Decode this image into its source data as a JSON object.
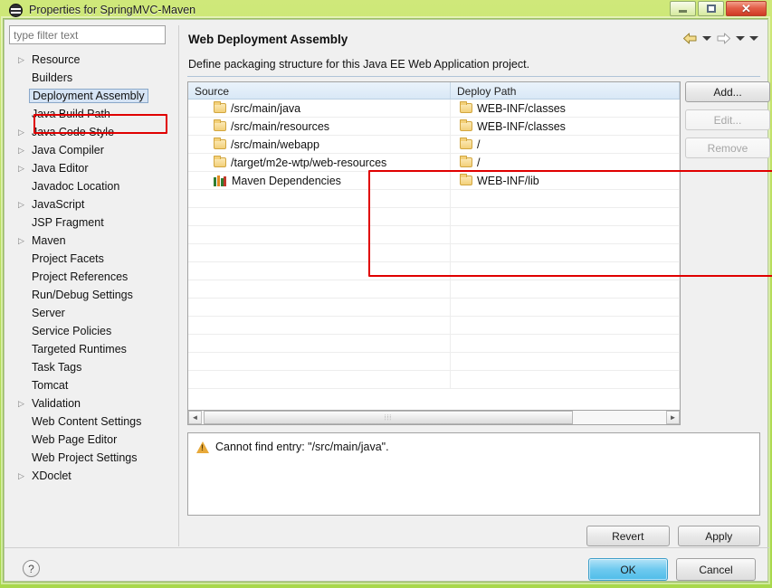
{
  "window": {
    "title": "Properties for SpringMVC-Maven",
    "app_icon": "eclipse-properties-icon",
    "controls": {
      "minimize": "minimize-icon",
      "maximize": "maximize-icon",
      "close": "✕"
    }
  },
  "sidebar": {
    "filter": {
      "placeholder": "type filter text",
      "value": ""
    },
    "items": [
      {
        "label": "Resource",
        "expandable": true,
        "selected": false
      },
      {
        "label": "Builders",
        "expandable": false,
        "selected": false
      },
      {
        "label": "Deployment Assembly",
        "expandable": false,
        "selected": true
      },
      {
        "label": "Java Build Path",
        "expandable": false,
        "selected": false
      },
      {
        "label": "Java Code Style",
        "expandable": true,
        "selected": false
      },
      {
        "label": "Java Compiler",
        "expandable": true,
        "selected": false
      },
      {
        "label": "Java Editor",
        "expandable": true,
        "selected": false
      },
      {
        "label": "Javadoc Location",
        "expandable": false,
        "selected": false
      },
      {
        "label": "JavaScript",
        "expandable": true,
        "selected": false
      },
      {
        "label": "JSP Fragment",
        "expandable": false,
        "selected": false
      },
      {
        "label": "Maven",
        "expandable": true,
        "selected": false
      },
      {
        "label": "Project Facets",
        "expandable": false,
        "selected": false
      },
      {
        "label": "Project References",
        "expandable": false,
        "selected": false
      },
      {
        "label": "Run/Debug Settings",
        "expandable": false,
        "selected": false
      },
      {
        "label": "Server",
        "expandable": false,
        "selected": false
      },
      {
        "label": "Service Policies",
        "expandable": false,
        "selected": false
      },
      {
        "label": "Targeted Runtimes",
        "expandable": false,
        "selected": false
      },
      {
        "label": "Task Tags",
        "expandable": false,
        "selected": false
      },
      {
        "label": "Tomcat",
        "expandable": false,
        "selected": false
      },
      {
        "label": "Validation",
        "expandable": true,
        "selected": false
      },
      {
        "label": "Web Content Settings",
        "expandable": false,
        "selected": false
      },
      {
        "label": "Web Page Editor",
        "expandable": false,
        "selected": false
      },
      {
        "label": "Web Project Settings",
        "expandable": false,
        "selected": false
      },
      {
        "label": "XDoclet",
        "expandable": true,
        "selected": false
      }
    ]
  },
  "page": {
    "title": "Web Deployment Assembly",
    "description": "Define packaging structure for this Java EE Web Application project.",
    "nav": {
      "back": "back-arrow-icon",
      "back_menu": "chevron-down-icon",
      "forward": "forward-arrow-icon",
      "forward_menu": "chevron-down-icon",
      "view_menu": "chevron-down-icon"
    }
  },
  "table": {
    "columns": [
      "Source",
      "Deploy Path"
    ],
    "rows": [
      {
        "icon": "folder-icon",
        "source": "/src/main/java",
        "deploy_icon": "folder-icon",
        "deploy": "WEB-INF/classes"
      },
      {
        "icon": "folder-icon",
        "source": "/src/main/resources",
        "deploy_icon": "folder-icon",
        "deploy": "WEB-INF/classes"
      },
      {
        "icon": "folder-icon",
        "source": "/src/main/webapp",
        "deploy_icon": "folder-icon",
        "deploy": "/"
      },
      {
        "icon": "folder-icon",
        "source": "/target/m2e-wtp/web-resources",
        "deploy_icon": "folder-icon",
        "deploy": "/"
      },
      {
        "icon": "books-icon",
        "source": "Maven Dependencies",
        "deploy_icon": "folder-icon",
        "deploy": "WEB-INF/lib"
      }
    ],
    "empty_row_count": 11,
    "scrollbar": {
      "left_arrow": "◄",
      "right_arrow": "►",
      "grip": "⦙⦙⦙"
    }
  },
  "side_buttons": [
    {
      "label": "Add...",
      "enabled": true
    },
    {
      "label": "Edit...",
      "enabled": false
    },
    {
      "label": "Remove",
      "enabled": false
    }
  ],
  "message": {
    "icon": "warning-icon",
    "text": "Cannot find entry: \"/src/main/java\"."
  },
  "footer": {
    "revert": "Revert",
    "apply": "Apply",
    "help": "?",
    "ok": "OK",
    "cancel": "Cancel"
  },
  "annotations": {
    "highlight_color": "#e00000",
    "sidebar_highlight": "Deployment Assembly",
    "table_highlight": "deployment assembly entries"
  }
}
